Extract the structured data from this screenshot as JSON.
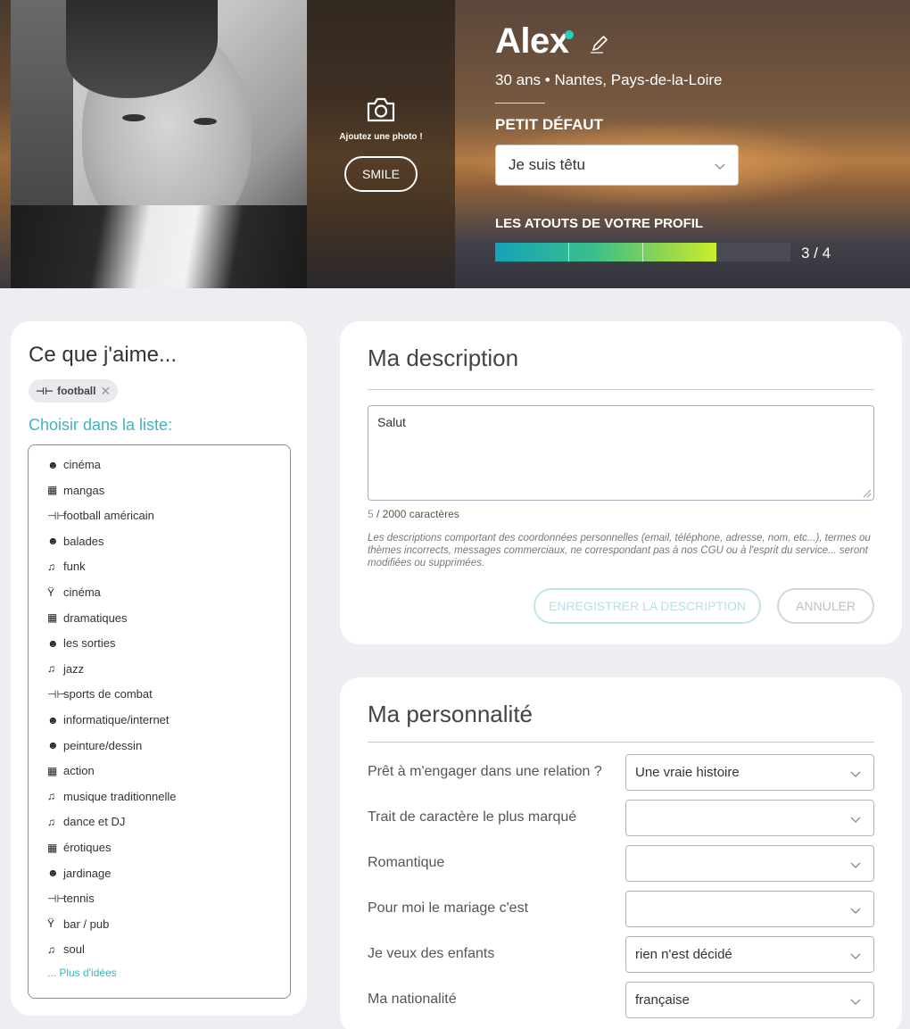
{
  "header": {
    "add_photo_label": "Ajoutez une photo !",
    "smile_button": "SMILE",
    "name": "Alex",
    "meta": "30 ans • Nantes,  Pays-de-la-Loire",
    "defaut_label": "PETIT DÉFAUT",
    "defaut_value": "Je suis têtu",
    "atouts_label": "LES ATOUTS DE VOTRE PROFIL",
    "atouts_progress": "3 / 4",
    "atouts_fraction": 0.75,
    "online_color": "#25d0b8"
  },
  "likes": {
    "title": "Ce que j'aime...",
    "selected_tag": {
      "label": "football",
      "icon": "dumbbell-icon"
    },
    "choose_label": "Choisir dans la liste:",
    "items": [
      {
        "label": "cinéma",
        "icon": "smiley-icon"
      },
      {
        "label": "mangas",
        "icon": "clapperboard-icon"
      },
      {
        "label": "football américain",
        "icon": "dumbbell-icon"
      },
      {
        "label": "balades",
        "icon": "smiley-icon"
      },
      {
        "label": "funk",
        "icon": "music-note-icon"
      },
      {
        "label": "cinéma",
        "icon": "cocktail-icon"
      },
      {
        "label": "dramatiques",
        "icon": "clapperboard-icon"
      },
      {
        "label": "les sorties",
        "icon": "smiley-icon"
      },
      {
        "label": "jazz",
        "icon": "music-note-icon"
      },
      {
        "label": "sports de combat",
        "icon": "dumbbell-icon"
      },
      {
        "label": "informatique/internet",
        "icon": "smiley-icon"
      },
      {
        "label": "peinture/dessin",
        "icon": "smiley-icon"
      },
      {
        "label": "action",
        "icon": "clapperboard-icon"
      },
      {
        "label": "musique traditionnelle",
        "icon": "music-note-icon"
      },
      {
        "label": "dance et DJ",
        "icon": "music-note-icon"
      },
      {
        "label": "érotiques",
        "icon": "clapperboard-icon"
      },
      {
        "label": "jardinage",
        "icon": "smiley-icon"
      },
      {
        "label": "tennis",
        "icon": "dumbbell-icon"
      },
      {
        "label": "bar / pub",
        "icon": "cocktail-icon"
      },
      {
        "label": "soul",
        "icon": "music-note-icon"
      }
    ],
    "more_ideas": "... Plus d'idées"
  },
  "description": {
    "title": "Ma description",
    "text": "Salut",
    "char_used": "5",
    "char_limit_text": " / 2000 caractères",
    "note": "Les descriptions comportant des coordonnées personnelles (email, téléphone, adresse, nom, etc...), termes ou thèmes incorrects, messages commerciaux, ne correspondant pas à nos CGU ou à l'esprit du service... seront modifiées ou supprimées.",
    "save_button": "ENREGISTRER LA DESCRIPTION",
    "cancel_button": "ANNULER"
  },
  "personality": {
    "title": "Ma personnalité",
    "fields": [
      {
        "label": "Prêt à m'engager dans une relation ?",
        "value": "Une vraie histoire"
      },
      {
        "label": "Trait de caractère le plus marqué",
        "value": ""
      },
      {
        "label": "Romantique",
        "value": ""
      },
      {
        "label": "Pour moi le mariage c'est",
        "value": ""
      },
      {
        "label": "Je veux des enfants",
        "value": "rien n'est décidé"
      },
      {
        "label": "Ma nationalité",
        "value": "française"
      }
    ]
  }
}
